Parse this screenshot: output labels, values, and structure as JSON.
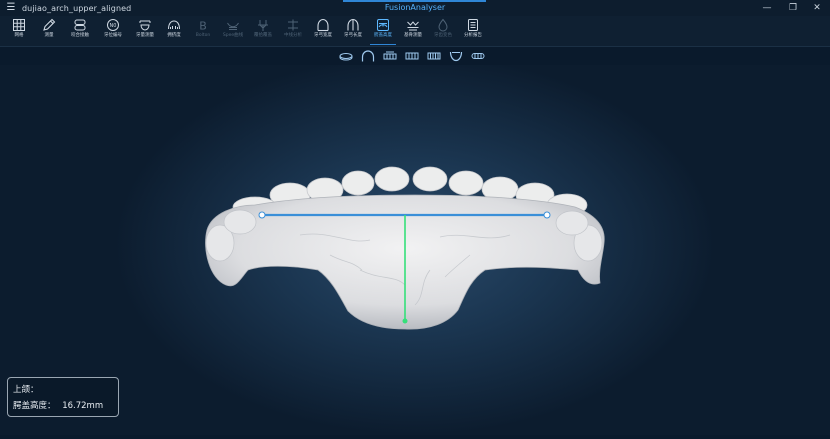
{
  "titlebar": {
    "menu_icon": "menu-icon",
    "document_name": "dujiao_arch_upper_aligned",
    "app_name": "FusionAnalyser",
    "window_controls": [
      "minimize-icon",
      "restore-icon",
      "close-icon"
    ]
  },
  "toolbar": {
    "tools": [
      {
        "label": "网格",
        "icon": "grid-icon",
        "enabled": true
      },
      {
        "label": "测量",
        "icon": "pencil-icon",
        "enabled": true
      },
      {
        "label": "咬合接触",
        "icon": "occlusion-icon",
        "enabled": true
      },
      {
        "label": "牙位编号",
        "icon": "tooth-number-icon",
        "enabled": true
      },
      {
        "label": "牙量测量",
        "icon": "tooth-measure-icon",
        "enabled": true
      },
      {
        "label": "拥挤度",
        "icon": "crowding-icon",
        "enabled": true
      },
      {
        "label": "Bolton",
        "icon": "bolton-icon",
        "enabled": false
      },
      {
        "label": "Spee曲线",
        "icon": "spee-curve-icon",
        "enabled": false
      },
      {
        "label": "覆拾覆盖",
        "icon": "overbite-icon",
        "enabled": false
      },
      {
        "label": "中线分析",
        "icon": "midline-icon",
        "enabled": false
      },
      {
        "label": "牙弓宽度",
        "icon": "arch-width-icon",
        "enabled": true
      },
      {
        "label": "牙弓长度",
        "icon": "arch-length-icon",
        "enabled": true
      },
      {
        "label": "腭盖高度",
        "icon": "palate-height-icon",
        "enabled": true,
        "active": true
      },
      {
        "label": "基骨测量",
        "icon": "basal-bone-icon",
        "enabled": true
      },
      {
        "label": "牙齿变色",
        "icon": "tooth-color-icon",
        "enabled": false
      },
      {
        "label": "分析报告",
        "icon": "report-icon",
        "enabled": true
      }
    ]
  },
  "view_toolbar": {
    "icons": [
      "view-bottom-icon",
      "view-front-icon",
      "view-left-icon",
      "view-right-icon",
      "view-back-icon",
      "view-top-icon",
      "view-occlusal-icon"
    ]
  },
  "info_panel": {
    "jaw_label": "上颌：",
    "measure_label": "腭盖高度：",
    "measure_value": "16.72mm"
  },
  "colors": {
    "accent": "#2f86d6",
    "width_line": "#3a8fd8",
    "height_line": "#35e07a",
    "model": "#e9eaec"
  }
}
